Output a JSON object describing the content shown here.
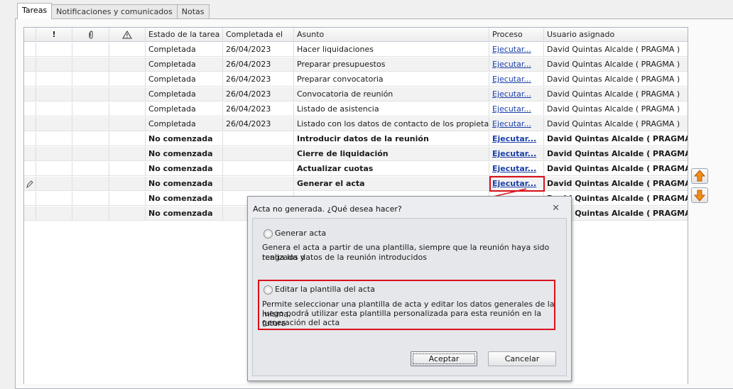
{
  "tabs": [
    {
      "label": "Tareas",
      "active": true
    },
    {
      "label": "Notificaciones y comunicados",
      "active": false
    },
    {
      "label": "Notas",
      "active": false
    }
  ],
  "grid": {
    "columns": [
      "",
      "!",
      "paperclip-icon",
      "warning-icon",
      "Estado de la tarea",
      "Completada el",
      "Asunto",
      "Proceso",
      "Usuario asignado"
    ],
    "header_labels": {
      "priority": "!",
      "status": "Estado de la tarea",
      "completed": "Completada el",
      "subject": "Asunto",
      "process": "Proceso",
      "user": "Usuario asignado"
    },
    "rows": [
      {
        "status": "Completada",
        "completed": "26/04/2023",
        "subject": "Hacer liquidaciones",
        "process": "Ejecutar...",
        "user": "David Quintas Alcalde ( PRAGMA )"
      },
      {
        "status": "Completada",
        "completed": "26/04/2023",
        "subject": "Preparar presupuestos",
        "process": "Ejecutar...",
        "user": "David Quintas Alcalde ( PRAGMA )"
      },
      {
        "status": "Completada",
        "completed": "26/04/2023",
        "subject": "Preparar convocatoria",
        "process": "Ejecutar...",
        "user": "David Quintas Alcalde ( PRAGMA )"
      },
      {
        "status": "Completada",
        "completed": "26/04/2023",
        "subject": "Convocatoria de reunión",
        "process": "Ejecutar...",
        "user": "David Quintas Alcalde ( PRAGMA )"
      },
      {
        "status": "Completada",
        "completed": "26/04/2023",
        "subject": "Listado de asistencia",
        "process": "Ejecutar...",
        "user": "David Quintas Alcalde ( PRAGMA )"
      },
      {
        "status": "Completada",
        "completed": "26/04/2023",
        "subject": "Listado con los datos de contacto de los propietarios",
        "process": "Ejecutar...",
        "user": "David Quintas Alcalde ( PRAGMA )"
      },
      {
        "status": "No comenzada",
        "completed": "",
        "subject": "Introducir datos de la reunión",
        "process": "Ejecutar...",
        "user": "David Quintas Alcalde ( PRAGMA )"
      },
      {
        "status": "No comenzada",
        "completed": "",
        "subject": "Cierre de liquidación",
        "process": "Ejecutar...",
        "user": "David Quintas Alcalde ( PRAGMA )"
      },
      {
        "status": "No comenzada",
        "completed": "",
        "subject": "Actualizar cuotas",
        "process": "Ejecutar...",
        "user": "David Quintas Alcalde ( PRAGMA )"
      },
      {
        "status": "No comenzada",
        "completed": "",
        "subject": "Generar el acta",
        "process": "Ejecutar...",
        "user": "David Quintas Alcalde ( PRAGMA )"
      },
      {
        "status": "No comenzada",
        "completed": "",
        "subject": "",
        "process": "",
        "user": "David Quintas Alcalde ( PRAGMA )"
      },
      {
        "status": "No comenzada",
        "completed": "",
        "subject": "",
        "process": "",
        "user": "David Quintas Alcalde ( PRAGMA )"
      }
    ]
  },
  "side_buttons": [
    "arrow-up-icon",
    "arrow-down-icon"
  ],
  "dialog": {
    "title": "Acta no generada. ¿Qué desea hacer?",
    "close": "✕",
    "option1_label": "Generar acta",
    "option1_desc_line1": "Genera el acta a partir de una plantilla, siempre que la reunión haya sido realizada y",
    "option1_desc_line2": "tenga los datos de la reunión introducidos",
    "option2_label": "Editar la plantilla del acta",
    "option2_desc_line1": "Permite seleccionar una plantilla de acta y editar los datos generales de la misma,",
    "option2_desc_line2": "luego podrá utilizar esta plantilla personalizada para esta reunión en la futura",
    "option2_desc_line3": "generación del acta",
    "accept": "Aceptar",
    "cancel": "Cancelar"
  },
  "colors": {
    "highlight": "#d9101b",
    "link": "#1b3fa8",
    "arrow_fill": "#f28c1a"
  }
}
